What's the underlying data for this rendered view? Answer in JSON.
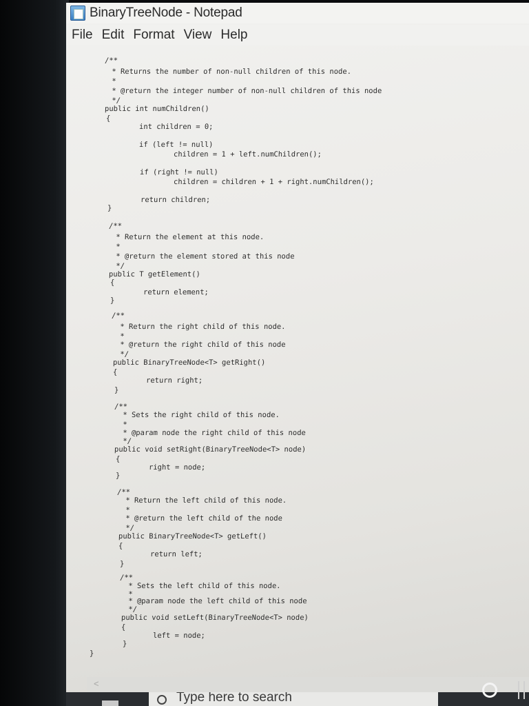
{
  "window": {
    "title": "BinaryTreeNode - Notepad"
  },
  "menu": [
    "File",
    "Edit",
    "Format",
    "View",
    "Help"
  ],
  "code_lines": [
    "/**",
    " * Returns the number of non-null children of this node.",
    " *",
    " * @return the integer number of non-null children of this node",
    " */",
    "public int numChildren()",
    "{",
    "int children = 0;",
    "if (left != null)",
    "children = 1 + left.numChildren();",
    "if (right != null)",
    "children = children + 1 + right.numChildren();",
    "return children;",
    "}",
    "/**",
    " * Return the element at this node.",
    " *",
    " * @return the element stored at this node",
    " */",
    "public T getElement()",
    "{",
    "return element;",
    "}",
    "/**",
    " * Return the right child of this node.",
    " *",
    " * @return the right child of this node",
    " */",
    "public BinaryTreeNode<T> getRight()",
    "{",
    "return right;",
    "}",
    "/**",
    " * Sets the right child of this node.",
    " *",
    " * @param node the right child of this node",
    " */",
    "public void setRight(BinaryTreeNode<T> node)",
    "{",
    "right = node;",
    "}",
    "/**",
    " * Return the left child of this node.",
    " *",
    " * @return the left child of the node",
    " */",
    "public BinaryTreeNode<T> getLeft()",
    "{",
    "return left;",
    "}",
    "/**",
    " * Sets the left child of this node.",
    " *",
    " * @param node the left child of this node",
    " */",
    "public void setLeft(BinaryTreeNode<T> node)",
    "{",
    "left = node;",
    "}",
    "}"
  ],
  "scrollbar": {
    "left_arrow": "<"
  },
  "taskbar": {
    "search_text": "Type here to search"
  },
  "icons": {
    "app": "notepad-icon",
    "search": "search-icon",
    "cortana": "cortana-icon",
    "taskview": "task-view-icon",
    "start": "windows-start-icon"
  }
}
